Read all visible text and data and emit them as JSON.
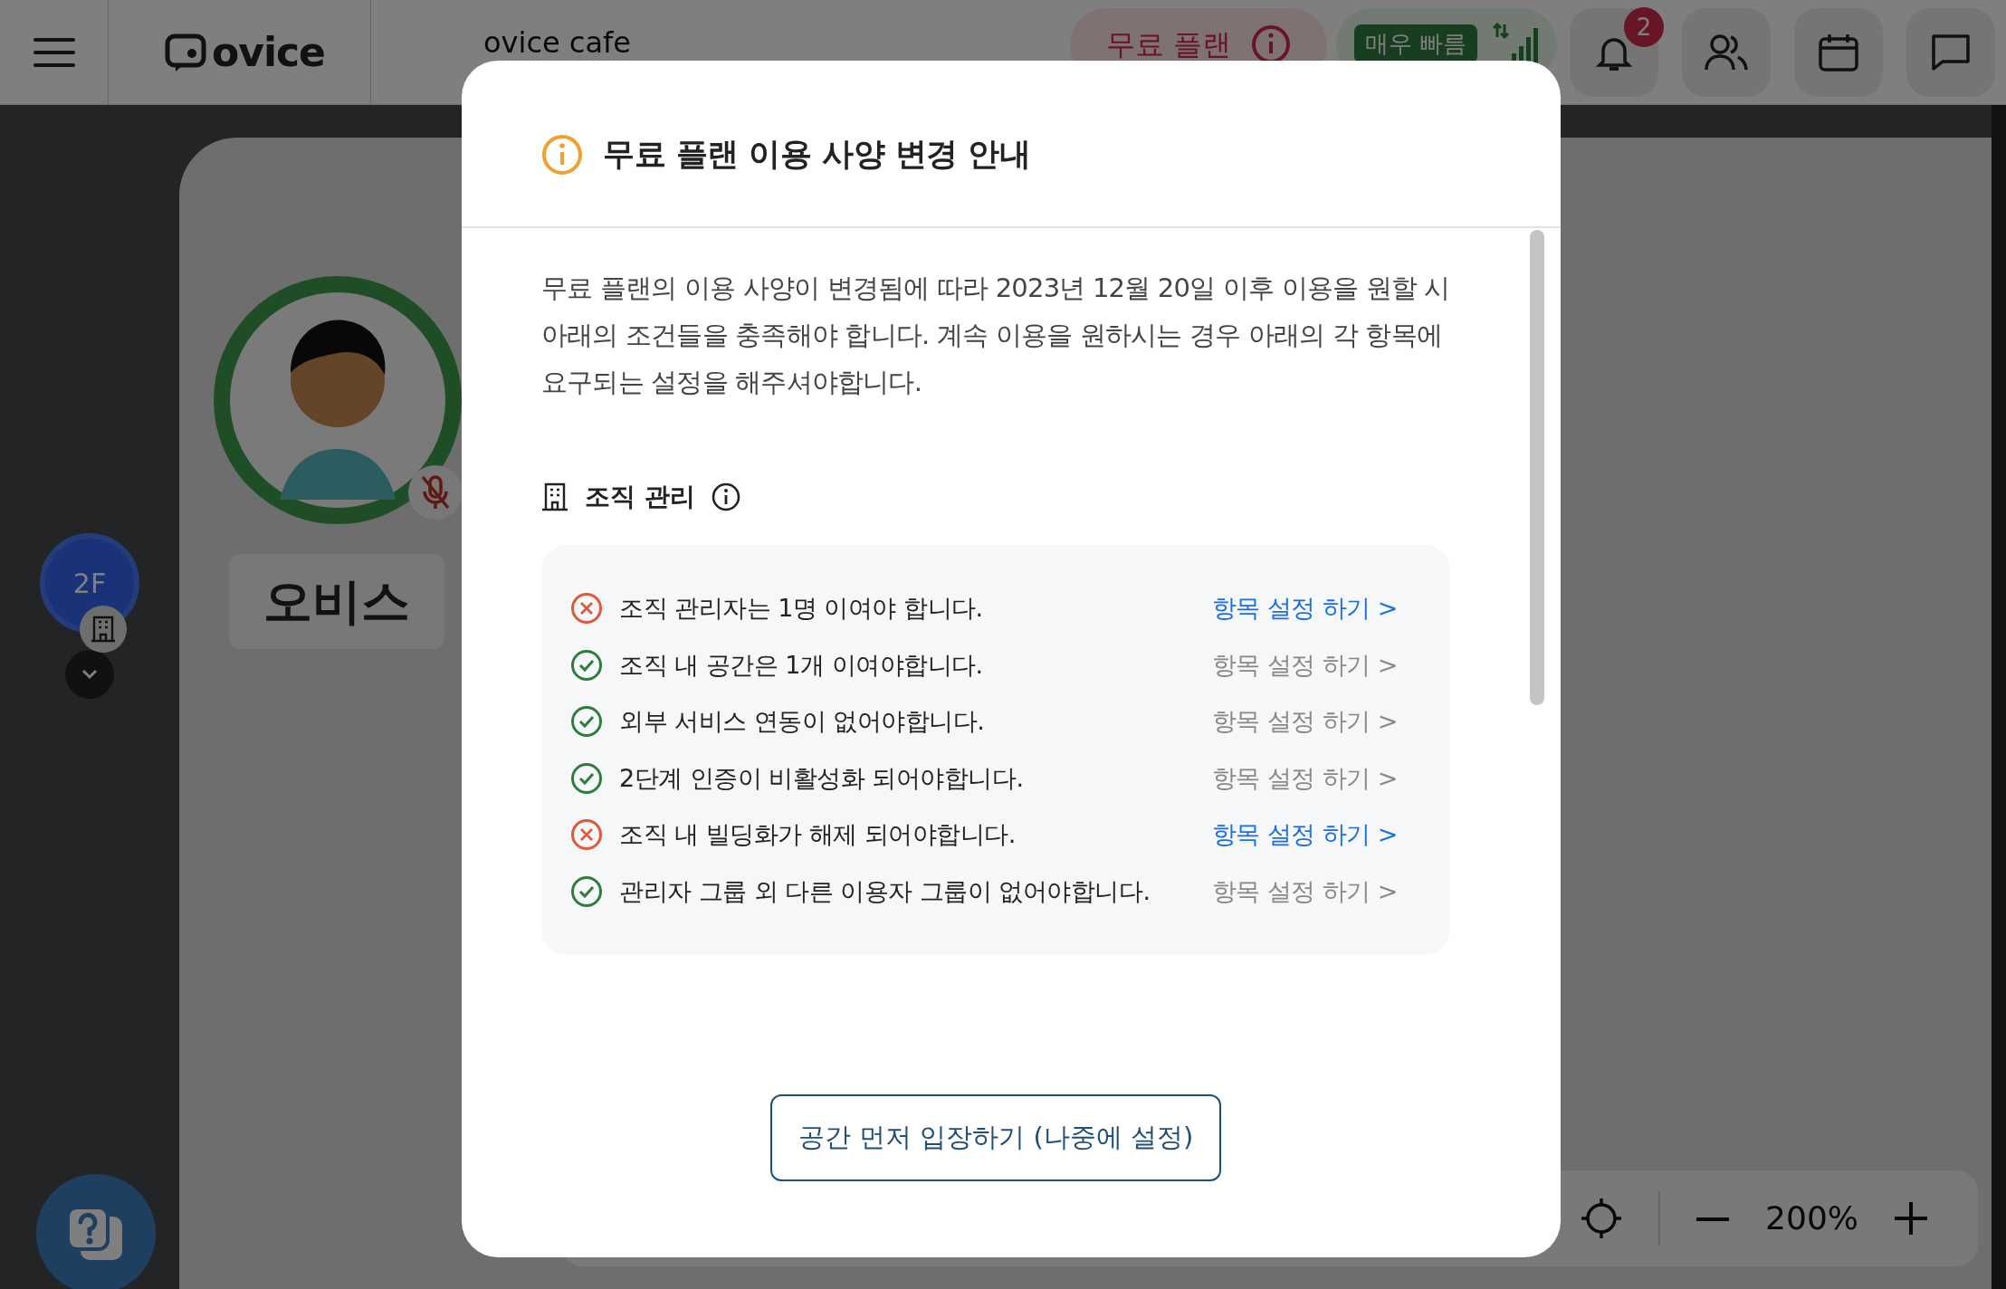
{
  "topbar": {
    "logo": "ovice",
    "space_name": "ovice cafe",
    "plan_badge": "무료 플랜",
    "connection": "매우 빠름",
    "notification_count": "2"
  },
  "floor": {
    "label": "2F"
  },
  "user": {
    "name": "오비스",
    "muted": true
  },
  "zoom": {
    "reading": "200%"
  },
  "modal": {
    "title": "무료 플랜 이용 사양 변경 안내",
    "message": "무료 플랜의 이용 사양이 변경됨에 따라 2023년 12월 20일 이후 이용을 원할 시 아래의 조건들을 충족해야 합니다. 계속 이용을 원하시는 경우 아래의 각 항목에 요구되는 설정을 해주셔야합니다.",
    "section": {
      "title": "조직 관리",
      "items": [
        {
          "text": "조직 관리자는 1명 이여야 합니다.",
          "satisfied": false,
          "link": "항목 설정 하기 >"
        },
        {
          "text": "조직 내 공간은 1개 이여야합니다.",
          "satisfied": true,
          "link": "항목 설정 하기 >"
        },
        {
          "text": "외부 서비스 연동이 없어야합니다.",
          "satisfied": true,
          "link": "항목 설정 하기 >"
        },
        {
          "text": "2단계 인증이 비활성화 되어야합니다.",
          "satisfied": true,
          "link": "항목 설정 하기 >"
        },
        {
          "text": "조직 내 빌딩화가 해제 되어야합니다.",
          "satisfied": false,
          "link": "항목 설정 하기 >"
        },
        {
          "text": "관리자 그룹 외 다른 이용자 그룹이 없어야합니다.",
          "satisfied": true,
          "link": "항목 설정 하기 >"
        }
      ]
    },
    "button": "공간 먼저 입장하기 (나중에 설정)"
  }
}
